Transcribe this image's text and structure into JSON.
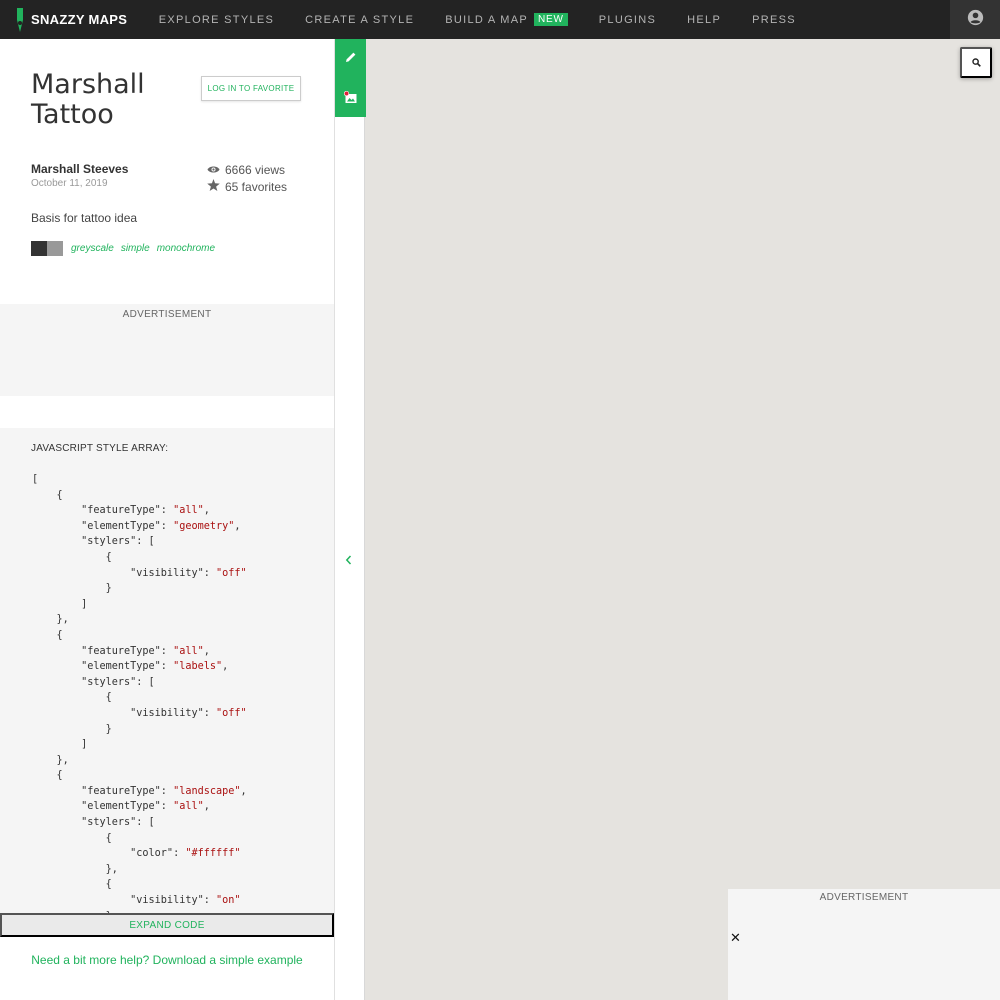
{
  "nav": {
    "logo": "SNAZZY MAPS",
    "items": [
      "EXPLORE STYLES",
      "CREATE A STYLE",
      "BUILD A MAP",
      "PLUGINS",
      "HELP",
      "PRESS"
    ],
    "new_badge": "NEW"
  },
  "style": {
    "title": "Marshall Tattoo",
    "favorite_button": "LOG IN TO FAVORITE",
    "author": "Marshall Steeves",
    "date": "October 11, 2019",
    "views": "6666 views",
    "favorites": "65 favorites",
    "description": "Basis for tattoo idea",
    "swatches": [
      "#333333",
      "#999999"
    ],
    "tags": [
      "greyscale",
      "simple",
      "monochrome"
    ]
  },
  "ads": {
    "label": "ADVERTISEMENT",
    "map_label": "ADVERTISEMENT",
    "close": "✕"
  },
  "code": {
    "heading": "JAVASCRIPT STYLE ARRAY:",
    "expand": "EXPAND CODE",
    "entries": [
      {
        "featureType": "all",
        "elementType": "geometry",
        "stylers": [
          {
            "visibility": "off"
          }
        ]
      },
      {
        "featureType": "all",
        "elementType": "labels",
        "stylers": [
          {
            "visibility": "off"
          }
        ]
      },
      {
        "featureType": "landscape",
        "elementType": "all",
        "stylers": [
          {
            "color": "#ffffff"
          },
          {
            "visibility": "on"
          }
        ]
      }
    ]
  },
  "help": {
    "link": "Need a bit more help? Download a simple example"
  },
  "colors": {
    "accent": "#21b35d",
    "nav_bg": "#232323",
    "map_bg": "#e5e3df"
  }
}
